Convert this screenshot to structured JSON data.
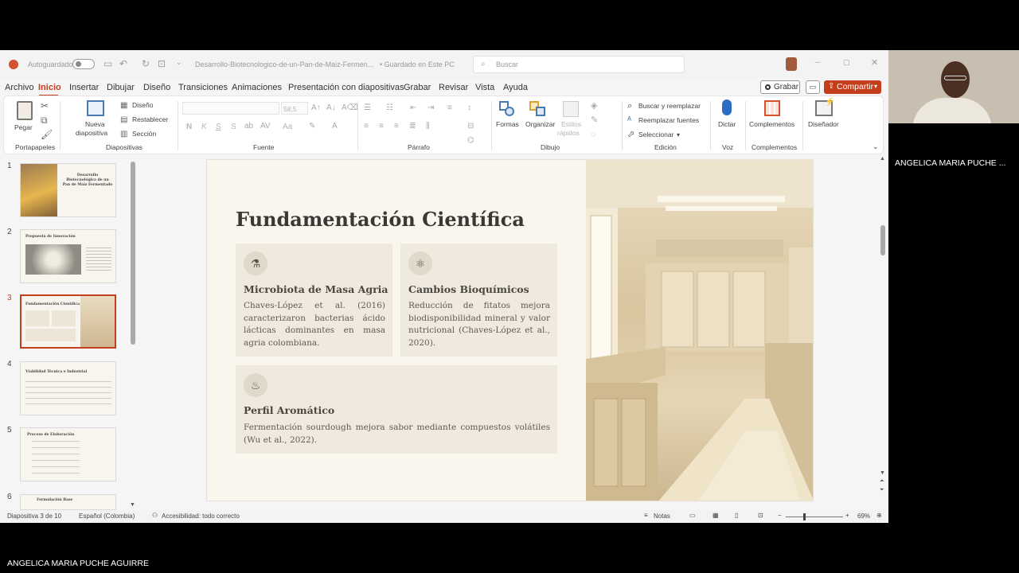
{
  "titlebar": {
    "autosave_label": "Autoguardado",
    "filename": "Desarrollo-Biotecnologico-de-un-Pan-de-Maiz-Fermen...",
    "save_status": "• Guardado en Este PC",
    "search_placeholder": "Buscar"
  },
  "menu": {
    "items": [
      "Archivo",
      "Inicio",
      "Insertar",
      "Dibujar",
      "Diseño",
      "Transiciones",
      "Animaciones",
      "Presentación con diapositivas",
      "Grabar",
      "Revisar",
      "Vista",
      "Ayuda"
    ],
    "active": "Inicio",
    "record_label": "Grabar",
    "share_label": "Compartir"
  },
  "ribbon": {
    "paste": "Pegar",
    "clipboard_group": "Portapapeles",
    "new_slide": "Nueva",
    "new_slide2": "diapositiva",
    "layout": "Diseño",
    "reset": "Restablecer",
    "section": "Sección",
    "slides_group": "Diapositivas",
    "font_size": "58,5",
    "font_group": "Fuente",
    "paragraph_group": "Párrafo",
    "shapes": "Formas",
    "arrange": "Organizar",
    "styles": "Estilos",
    "styles2": "rápidos",
    "drawing_group": "Dibujo",
    "find_replace": "Buscar y reemplazar",
    "replace_fonts": "Reemplazar fuentes",
    "select": "Seleccionar",
    "editing_group": "Edición",
    "dictate": "Dictar",
    "voice_group": "Voz",
    "addins": "Complementos",
    "addins_group": "Complementos",
    "designer": "Diseñador",
    "bold": "N",
    "italic": "K",
    "underline": "S",
    "strike": "S",
    "fontcase": "Aa"
  },
  "thumbnails": [
    {
      "num": "1",
      "title": "Desarrollo Biotecnológico de un Pan de Maíz Fermentado"
    },
    {
      "num": "2",
      "title": "Propuesta de Innovación"
    },
    {
      "num": "3",
      "title": "Fundamentación Científica"
    },
    {
      "num": "4",
      "title": "Viabilidad Técnica e Industrial"
    },
    {
      "num": "5",
      "title": "Proceso de Elaboración"
    },
    {
      "num": "6",
      "title": "Formulación Base"
    }
  ],
  "slide": {
    "title": "Fundamentación Científica",
    "cards": [
      {
        "icon": "microscope-icon",
        "title": "Microbiota de Masa Agria",
        "body": "Chaves-López et al. (2016) caracterizaron bacterias ácido lácticas dominantes en masa agria colombiana."
      },
      {
        "icon": "molecule-icon",
        "title": "Cambios Bioquímicos",
        "body": "Reducción de fitatos mejora biodisponibilidad mineral y valor nutricional (Chaves-López et al., 2020)."
      },
      {
        "icon": "aroma-icon",
        "title": "Perfil Aromático",
        "body": "Fermentación sourdough mejora sabor mediante compuestos volátiles (Wu et al., 2022)."
      }
    ]
  },
  "status": {
    "slide_counter": "Diapositiva 3 de 10",
    "language": "Español (Colombia)",
    "accessibility": "Accesibilidad: todo correcto",
    "notes": "Notas",
    "zoom": "69%"
  },
  "meeting": {
    "participant_tile": "ANGELICA MARIA PUCHE ...",
    "speaker_name": "ANGELICA MARIA PUCHE AGUIRRE"
  },
  "colors": {
    "accent": "#c43e1c",
    "slide_bg": "#f9f6ee",
    "card_bg": "#efe9de"
  }
}
